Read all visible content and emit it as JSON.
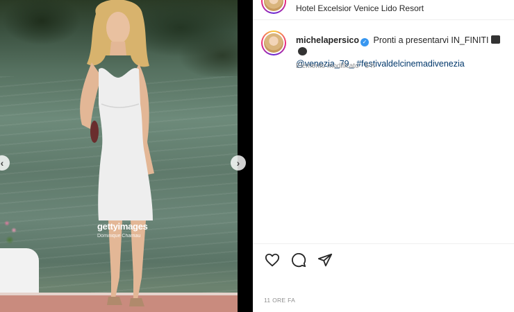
{
  "post": {
    "location": "Hotel Excelsior Venice Lido Resort",
    "username": "michelapersico",
    "caption_text": "Pronti a presentarvi IN_FINITI",
    "caption_emoji_names": [
      "clapper-board-emoji",
      "film-camera-emoji"
    ],
    "mention": "@venezia_79_",
    "hashtag": "#festivaldelcinemadivenezia",
    "edited_label": "Elemento modificato",
    "meta_separator": "·",
    "caption_age": "5 h",
    "post_age": "11 ORE FA"
  },
  "photo": {
    "watermark_brand": "gettyimages",
    "watermark_credit": "Dominique Charriau"
  },
  "icons": [
    "heart-icon",
    "comment-icon",
    "share-icon",
    "verified-badge-icon",
    "chevron-left-icon",
    "chevron-right-icon"
  ],
  "colors": {
    "verified": "#3897f0",
    "link": "#00376b",
    "secondary_text": "#8e8e8e",
    "primary_text": "#262626"
  }
}
